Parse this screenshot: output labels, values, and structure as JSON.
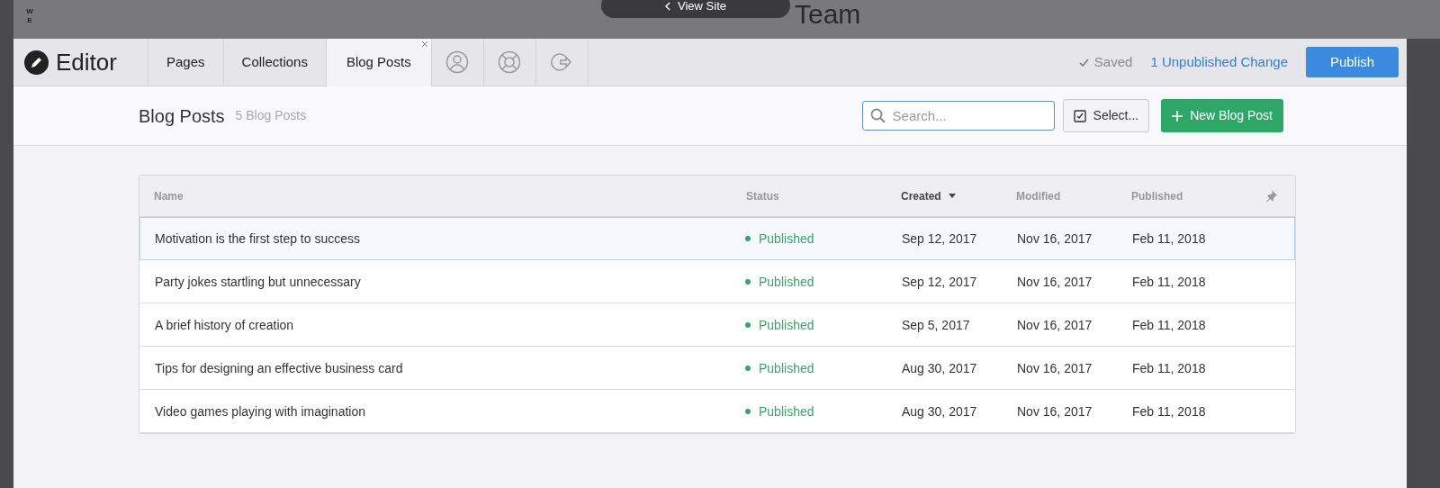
{
  "backdrop": {
    "site_title": "Team",
    "view_site": "View Site",
    "side_label": "WE"
  },
  "editor": {
    "logo": "Editor",
    "tabs": [
      {
        "label": "Pages",
        "selected": false
      },
      {
        "label": "Collections",
        "selected": false
      },
      {
        "label": "Blog Posts",
        "selected": true,
        "closable": true
      }
    ],
    "icon_tabs": [
      {
        "kind": "user"
      },
      {
        "kind": "help"
      },
      {
        "kind": "exit"
      }
    ],
    "saved": "Saved",
    "unpublished": "1 Unpublished Change",
    "publish": "Publish"
  },
  "header": {
    "title": "Blog Posts",
    "count": "5 Blog Posts",
    "search": {
      "placeholder": "Search..."
    },
    "select": "Select...",
    "new_post": "New Blog Post"
  },
  "table": {
    "columns": [
      {
        "label": "Name",
        "sorted": false
      },
      {
        "label": "Status",
        "sorted": false
      },
      {
        "label": "Created",
        "sorted": true
      },
      {
        "label": "Modified",
        "sorted": false
      },
      {
        "label": "Published",
        "sorted": false
      }
    ],
    "rows": [
      {
        "name": "Motivation is the first step to success",
        "status": "Published",
        "color": "#3aa36b",
        "created": "Sep 12, 2017",
        "modified": "Nov 16, 2017",
        "published": "Feb 11, 2018",
        "highlighted": true
      },
      {
        "name": "Party jokes startling but unnecessary",
        "status": "Published",
        "color": "#3aa36b",
        "created": "Sep 12, 2017",
        "modified": "Nov 16, 2017",
        "published": "Feb 11, 2018",
        "highlighted": false
      },
      {
        "name": "A brief history of creation",
        "status": "Published",
        "color": "#3aa36b",
        "created": "Sep 5, 2017",
        "modified": "Nov 16, 2017",
        "published": "Feb 11, 2018",
        "highlighted": false
      },
      {
        "name": "Tips for designing an effective business card",
        "status": "Published",
        "color": "#3aa36b",
        "created": "Aug 30, 2017",
        "modified": "Nov 16, 2017",
        "published": "Feb 11, 2018",
        "highlighted": false
      },
      {
        "name": "Video games playing with imagination",
        "status": "Published",
        "color": "#3aa36b",
        "created": "Aug 30, 2017",
        "modified": "Nov 16, 2017",
        "published": "Feb 11, 2018",
        "highlighted": false
      }
    ]
  }
}
